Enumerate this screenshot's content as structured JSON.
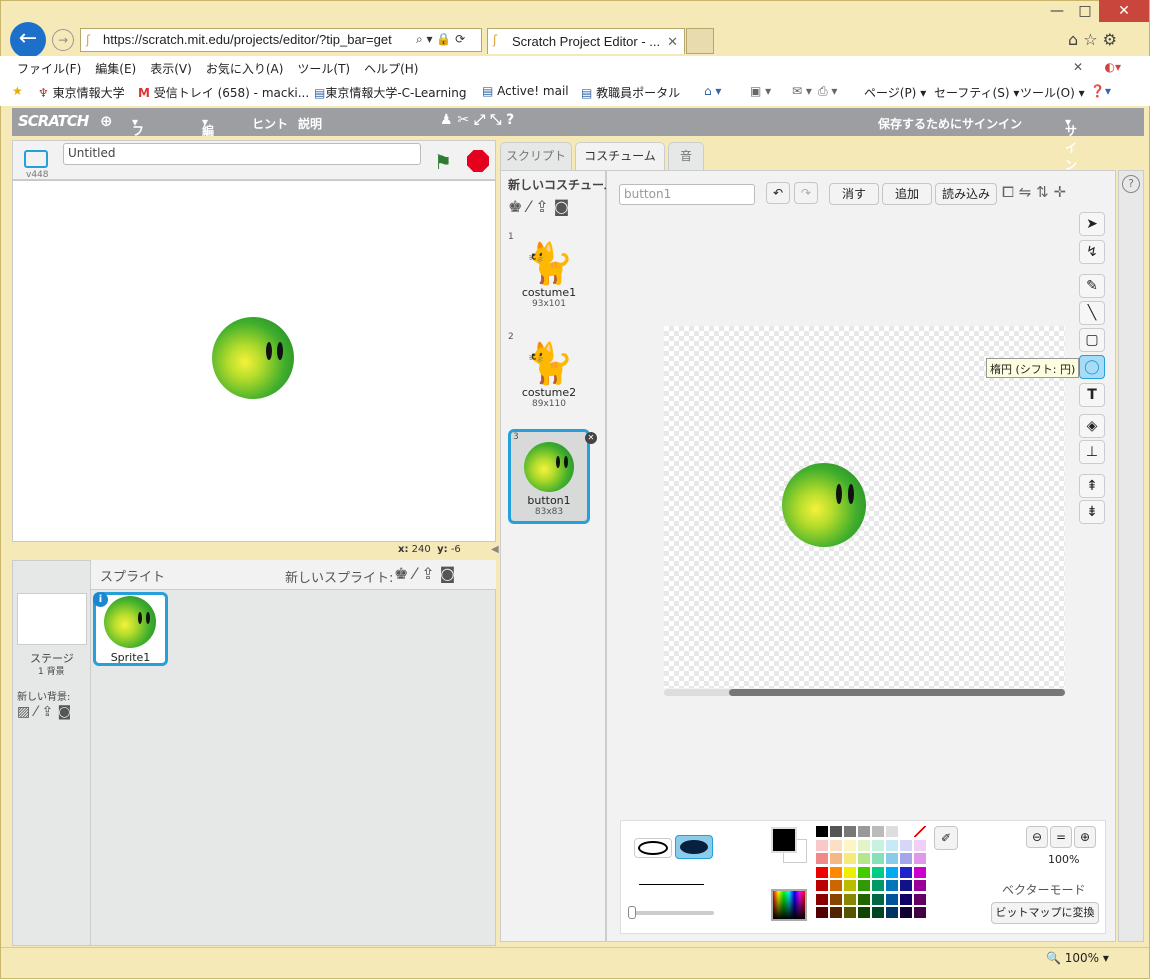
{
  "browser": {
    "address": "https://scratch.mit.edu/projects/editor/?tip_bar=get",
    "tab_title": "Scratch Project Editor - ...",
    "menu": [
      "ファイル(F)",
      "編集(E)",
      "表示(V)",
      "お気に入り(A)",
      "ツール(T)",
      "ヘルプ(H)"
    ],
    "favorites": [
      "東京情報大学",
      "受信トレイ (658) - macki...",
      "東京情報大学-C-Learning",
      "Active! mail",
      "教職員ポータル"
    ],
    "cmd": {
      "page": "ページ(P)",
      "safety": "セーフティ(S)",
      "tools": "ツール(O)"
    },
    "zoom": "100%"
  },
  "scratch": {
    "logo": "SCRATCH",
    "menu": {
      "file": "ファイル",
      "edit": "編集",
      "tips": "ヒント",
      "about": "説明"
    },
    "save_signin": "保存するためにサインイン",
    "signin": "サインイン",
    "version": "v448",
    "project_title": "Untitled",
    "coords": {
      "x_label": "x:",
      "x": "240",
      "y_label": "y:",
      "y": "-6"
    },
    "tabs": {
      "scripts": "スクリプト",
      "costumes": "コスチューム",
      "sounds": "音"
    },
    "sprites_header": "スプライト",
    "new_sprite": "新しいスプライト:",
    "stage": {
      "label": "ステージ",
      "count": "1 背景",
      "new_backdrop": "新しい背景:"
    },
    "sprite_name": "Sprite1",
    "new_costume": "新しいコスチューム:",
    "costumes": [
      {
        "num": "1",
        "name": "costume1",
        "size": "93x101"
      },
      {
        "num": "2",
        "name": "costume2",
        "size": "89x110"
      },
      {
        "num": "3",
        "name": "button1",
        "size": "83x83"
      }
    ],
    "costume_name": "button1",
    "buttons": {
      "clear": "消す",
      "add": "追加",
      "import": "読み込み"
    },
    "tooltip": "楕円 (シフト: 円)",
    "zoom": "100%",
    "mode": "ベクターモード",
    "convert": "ビットマップに変換"
  },
  "colors": {
    "accent": "#25a0db",
    "topbar": "#9c9ea2",
    "stop": "#e6001f",
    "flag": "#2e7d32"
  }
}
